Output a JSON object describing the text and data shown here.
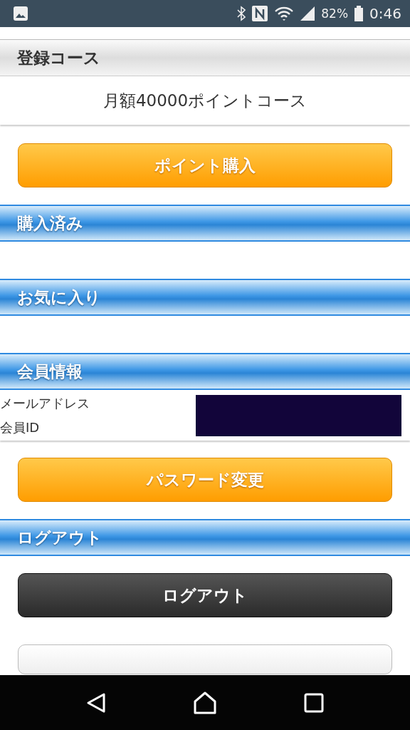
{
  "status_bar": {
    "battery": "82%",
    "time": "0:46"
  },
  "sections": [
    {
      "kind": "gray",
      "title": "登録コース"
    },
    {
      "kind": "text",
      "text": "月額40000ポイントコース"
    },
    {
      "kind": "button",
      "label": "ポイント購入"
    },
    {
      "kind": "blue",
      "title": "購入済み"
    },
    {
      "kind": "empty"
    },
    {
      "kind": "blue",
      "title": "お気に入り"
    },
    {
      "kind": "empty"
    },
    {
      "kind": "blue",
      "title": "会員情報"
    },
    {
      "kind": "info",
      "labels": [
        "メールアドレス",
        "会員ID"
      ]
    },
    {
      "kind": "button",
      "label": "パスワード変更"
    },
    {
      "kind": "blue",
      "title": "ログアウト"
    },
    {
      "kind": "dark_button",
      "label": "ログアウト"
    },
    {
      "kind": "partial"
    }
  ]
}
